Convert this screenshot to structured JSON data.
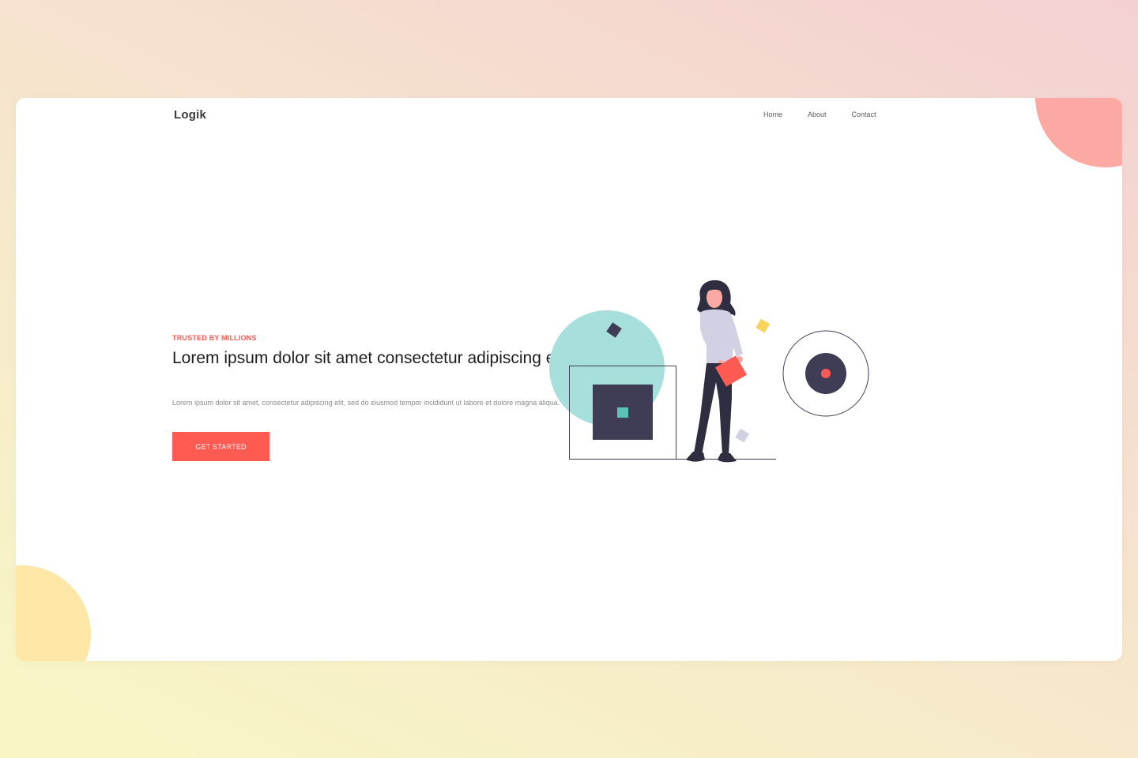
{
  "brand": {
    "name": "Logik",
    "accent": "#ff5b52"
  },
  "nav": {
    "items": [
      {
        "label": "Home"
      },
      {
        "label": "About"
      },
      {
        "label": "Contact"
      }
    ]
  },
  "hero": {
    "eyebrow": "TRUSTED BY MILLIONS",
    "headline": "Lorem ipsum dolor sit amet consectetur adipiscing elit",
    "body": "Lorem ipsum dolor sit amet, consectetur adipiscing elit, sed do eiusmod tempor incididunt ut labore et dolore magna aliqua.",
    "cta_label": "GET STARTED"
  },
  "illustration": {
    "subject": "woman-holding-paper-illustration",
    "colors": {
      "teal": "#a6dfdb",
      "dark": "#3f3d56",
      "coral": "#ff5b52",
      "yellow": "#f9d45c",
      "lavender": "#d2d0e3"
    }
  },
  "decor": {
    "top_right_blob_color": "#fca8a3",
    "bottom_left_blob_color": "#fde6a6"
  }
}
